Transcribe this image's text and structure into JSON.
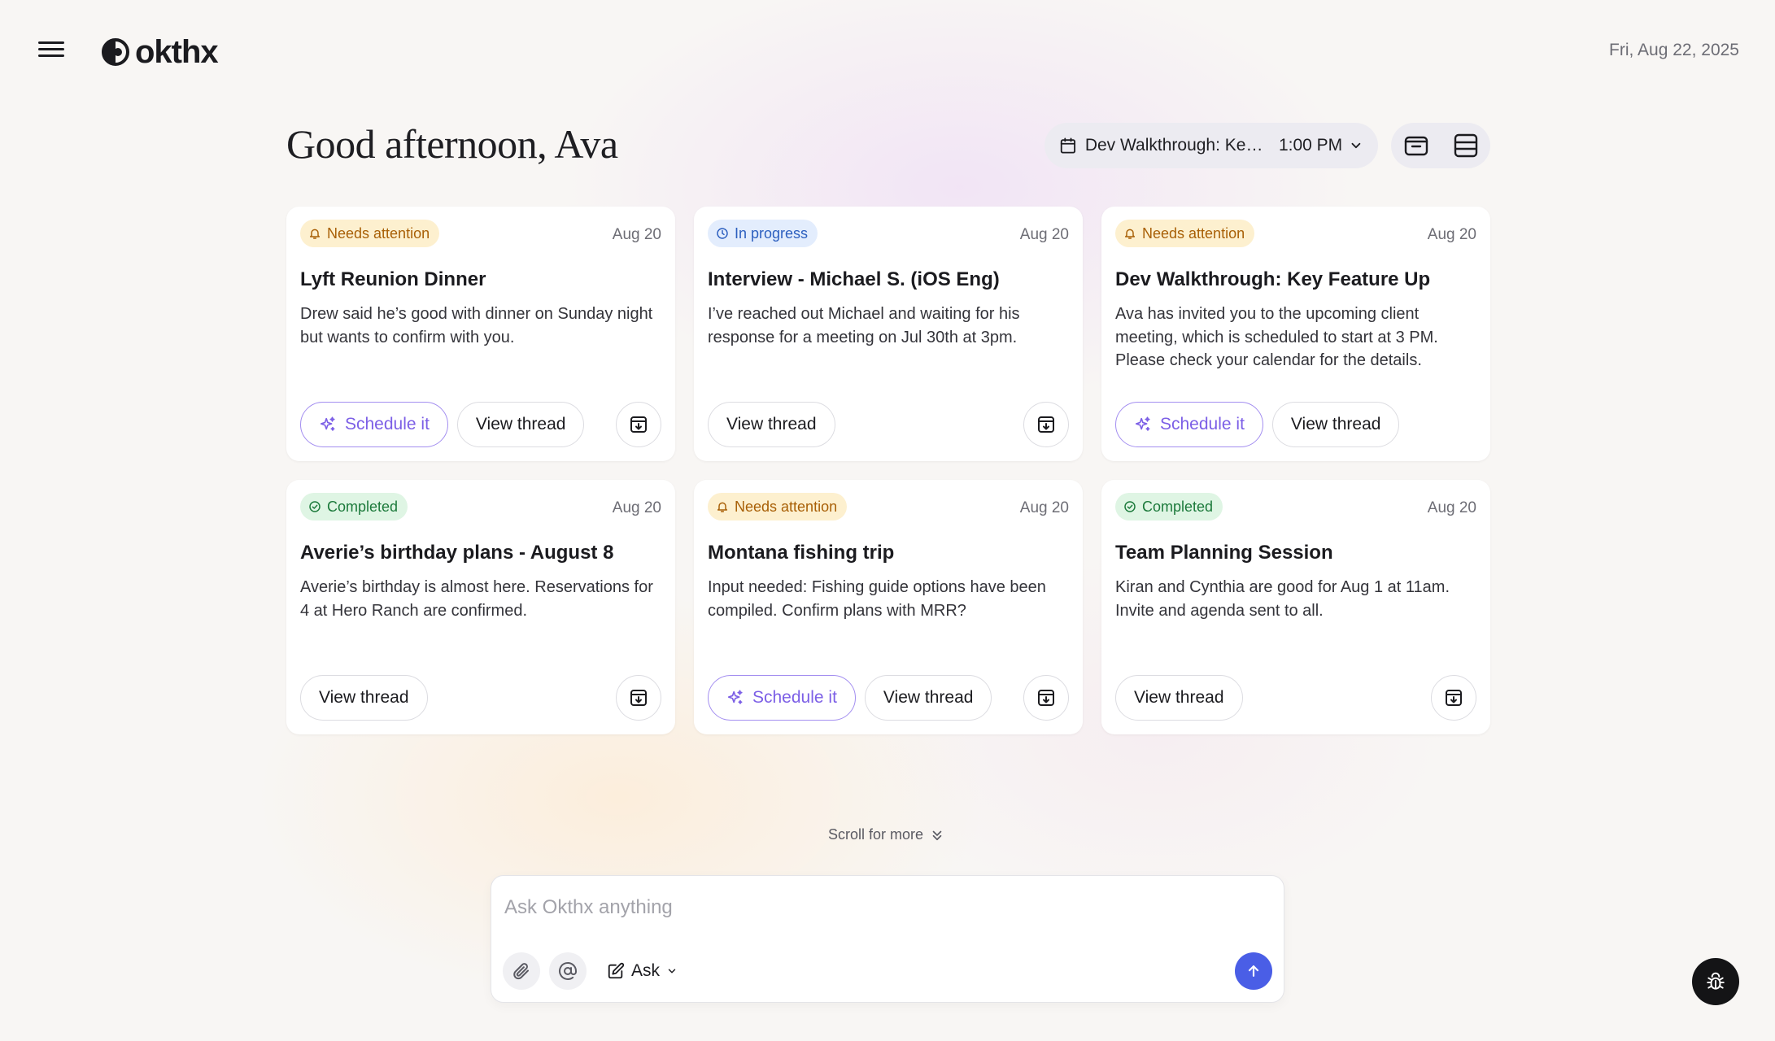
{
  "app": {
    "name": "okthx",
    "date": "Fri, Aug 22, 2025"
  },
  "greeting": "Good afternoon, Ava",
  "event": {
    "title": "Dev Walkthrough: Key...",
    "time": "1:00 PM"
  },
  "cards": [
    {
      "status": "Needs attention",
      "status_type": "attention",
      "date": "Aug 20",
      "title": "Lyft Reunion Dinner",
      "description": "Drew said he’s good with dinner on Sunday night but wants to confirm with you.",
      "schedule_label": "Schedule it",
      "view_label": "View thread"
    },
    {
      "status": "In progress",
      "status_type": "progress",
      "date": "Aug 20",
      "title": "Interview - Michael S. (iOS Eng)",
      "description": "I’ve reached out Michael and waiting for his response for a meeting on Jul 30th at 3pm.",
      "view_label": "View thread"
    },
    {
      "status": "Needs attention",
      "status_type": "attention",
      "date": "Aug 20",
      "title": "Dev Walkthrough: Key Feature Up",
      "description": "Ava has invited you to the upcoming client meeting, which is scheduled to start at 3 PM. Please check your calendar for the details.",
      "schedule_label": "Schedule it",
      "view_label": "View thread"
    },
    {
      "status": "Completed",
      "status_type": "completed",
      "date": "Aug 20",
      "title": "Averie’s birthday plans - August 8",
      "description": "Averie’s birthday is almost here. Reservations for 4 at Hero Ranch are confirmed.",
      "view_label": "View thread"
    },
    {
      "status": "Needs attention",
      "status_type": "attention",
      "date": "Aug 20",
      "title": "Montana fishing trip",
      "description": "Input needed: Fishing guide options have been compiled. Confirm plans with MRR?",
      "schedule_label": "Schedule it",
      "view_label": "View thread"
    },
    {
      "status": "Completed",
      "status_type": "completed",
      "date": "Aug 20",
      "title": "Team Planning Session",
      "description": "Kiran and Cynthia are good for Aug 1 at 11am. Invite and agenda sent to all.",
      "view_label": "View thread"
    }
  ],
  "scroll_more": "Scroll for more",
  "ask": {
    "placeholder": "Ask Okthx anything",
    "mode": "Ask"
  },
  "icons": {
    "menu": "hamburger-icon",
    "logo": "okthx-logo-icon",
    "calendar": "calendar-icon",
    "chevron": "chevron-down-icon",
    "bell": "bell-icon",
    "clock": "clock-icon",
    "check": "check-circle-icon",
    "sparkle": "sparkle-icon",
    "archive": "archive-icon",
    "attach": "paperclip-icon",
    "mention": "at-sign-icon",
    "edit": "pencil-square-icon",
    "send": "arrow-up-icon",
    "bug": "bug-icon"
  },
  "colors": {
    "accent": "#4a5ee6",
    "schedule": "#7c5fe6",
    "attention": "#a85f06",
    "progress": "#2c5fbf",
    "completed": "#1c7a3b"
  }
}
